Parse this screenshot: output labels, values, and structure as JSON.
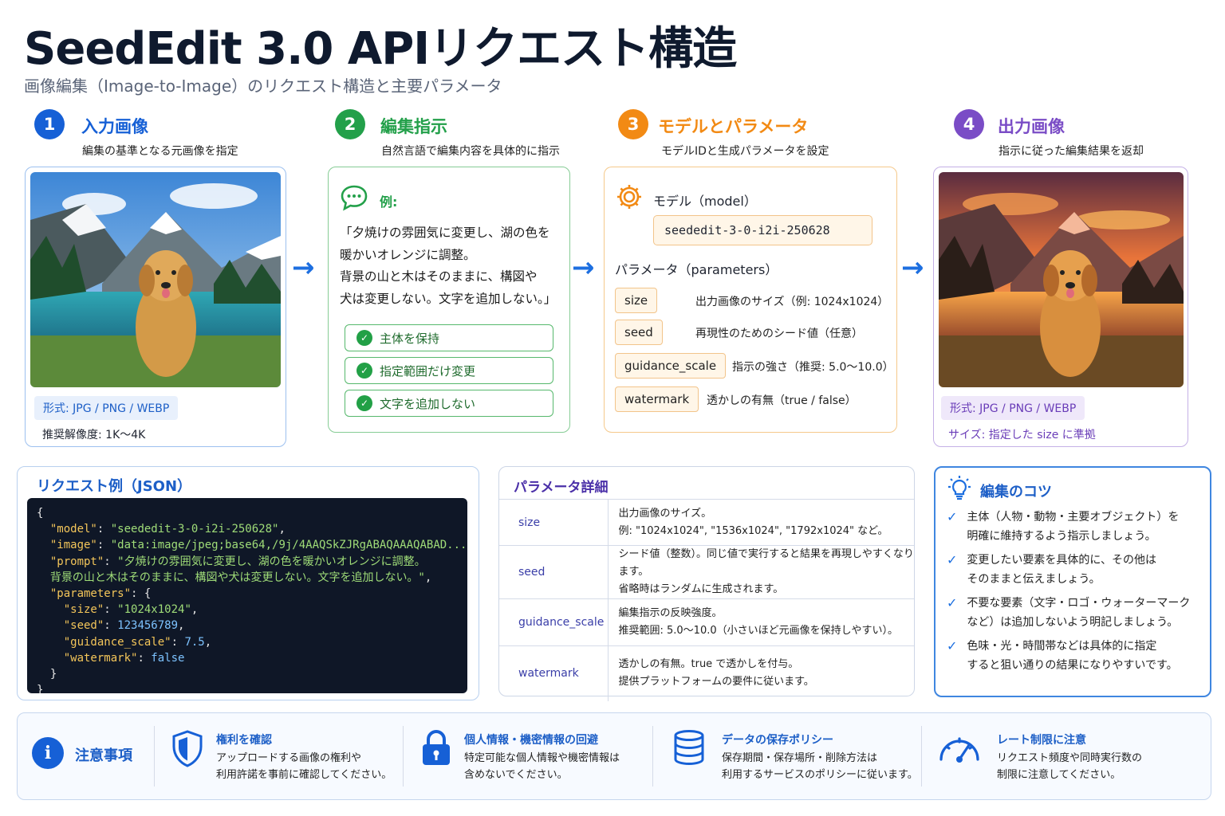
{
  "header": {
    "title": "SeedEdit 3.0 APIリクエスト構造",
    "subtitle": "画像編集（Image-to-Image）のリクエスト構造と主要パラメータ"
  },
  "colors": {
    "blue": "#1660d6",
    "green": "#23a04a",
    "orange": "#f28a14",
    "purple": "#7a4cc6"
  },
  "steps": [
    {
      "num": "1",
      "title": "入力画像",
      "desc": "編集の基準となる元画像を指定"
    },
    {
      "num": "2",
      "title": "編集指示",
      "desc": "自然言語で編集内容を具体的に指示"
    },
    {
      "num": "3",
      "title": "モデルとパラメータ",
      "desc": "モデルIDと生成パラメータを設定"
    },
    {
      "num": "4",
      "title": "出力画像",
      "desc": "指示に従った編集結果を返却"
    }
  ],
  "input_card": {
    "format": "形式: JPG / PNG / WEBP",
    "resolution": "推奨解像度: 1K〜4K"
  },
  "instruction_card": {
    "example_label": "例:",
    "quote_lines": [
      "「夕焼けの雰囲気に変更し、湖の色を",
      "暖かいオレンジに調整。",
      "背景の山と木はそのままに、構図や",
      "犬は変更しない。文字を追加しない。」"
    ],
    "checks": [
      "主体を保持",
      "指定範囲だけ変更",
      "文字を追加しない"
    ]
  },
  "model_card": {
    "model_label": "モデル（model）",
    "model_id": "seededit-3-0-i2i-250628",
    "params_label": "パラメータ（parameters）",
    "params": [
      {
        "name": "size",
        "desc": "出力画像のサイズ（例: 1024x1024）"
      },
      {
        "name": "seed",
        "desc": "再現性のためのシード値（任意）"
      },
      {
        "name": "guidance_scale",
        "desc": "指示の強さ（推奨: 5.0〜10.0）"
      },
      {
        "name": "watermark",
        "desc": "透かしの有無（true / false）"
      }
    ]
  },
  "output_card": {
    "format": "形式: JPG / PNG / WEBP",
    "size_note": "サイズ: 指定した size に準拠"
  },
  "request_example": {
    "title": "リクエスト例（JSON）",
    "brace_open": "{",
    "brace_close": "}",
    "model_key": "\"model\"",
    "model_val": "\"seededit-3-0-i2i-250628\"",
    "image_key": "\"image\"",
    "image_val": "\"data:image/jpeg;base64,/9j/4AAQSkZJRgABAQAAAQABAD...\"",
    "prompt_key": "\"prompt\"",
    "prompt_val1": "\"夕焼けの雰囲気に変更し、湖の色を暖かいオレンジに調整。",
    "prompt_val2": "背景の山と木はそのままに、構図や犬は変更しない。文字を追加しない。\"",
    "params_key": "\"parameters\"",
    "size_key": "\"size\"",
    "size_val": "\"1024x1024\"",
    "seed_key": "\"seed\"",
    "seed_val": "123456789",
    "gs_key": "\"guidance_scale\"",
    "gs_val": "7.5",
    "wm_key": "\"watermark\"",
    "wm_val": "false",
    "inner_close": "}"
  },
  "param_details": {
    "title": "パラメータ詳細",
    "rows": [
      {
        "name": "size",
        "line1": "出力画像のサイズ。",
        "line2": "例: \"1024x1024\", \"1536x1024\", \"1792x1024\" など。"
      },
      {
        "name": "seed",
        "line1": "シード値（整数）。同じ値で実行すると結果を再現しやすくなります。",
        "line2": "省略時はランダムに生成されます。"
      },
      {
        "name": "guidance_scale",
        "line1": "編集指示の反映強度。",
        "line2": "推奨範囲: 5.0〜10.0（小さいほど元画像を保持しやすい）。"
      },
      {
        "name": "watermark",
        "line1": "透かしの有無。true で透かしを付与。",
        "line2": "提供プラットフォームの要件に従います。"
      }
    ]
  },
  "tips": {
    "title": "編集のコツ",
    "items": [
      {
        "line1": "主体（人物・動物・主要オブジェクト）を",
        "line2": "明確に維持するよう指示しましょう。"
      },
      {
        "line1": "変更したい要素を具体的に、その他は",
        "line2": "そのままと伝えましょう。"
      },
      {
        "line1": "不要な要素（文字・ロゴ・ウォーターマーク",
        "line2": "など）は追加しないよう明記しましょう。"
      },
      {
        "line1": "色味・光・時間帯などは具体的に指定",
        "line2": "すると狙い通りの結果になりやすいです。"
      }
    ]
  },
  "notes": {
    "title": "注意事項",
    "items": [
      {
        "icon": "shield-icon",
        "heading": "権利を確認",
        "line1": "アップロードする画像の権利や",
        "line2": "利用許諾を事前に確認してください。"
      },
      {
        "icon": "lock-icon",
        "heading": "個人情報・機密情報の回避",
        "line1": "特定可能な個人情報や機密情報は",
        "line2": "含めないでください。"
      },
      {
        "icon": "database-icon",
        "heading": "データの保存ポリシー",
        "line1": "保存期間・保存場所・削除方法は",
        "line2": "利用するサービスのポリシーに従います。"
      },
      {
        "icon": "gauge-icon",
        "heading": "レート制限に注意",
        "line1": "リクエスト頻度や同時実行数の",
        "line2": "制限に注意してください。"
      }
    ]
  }
}
